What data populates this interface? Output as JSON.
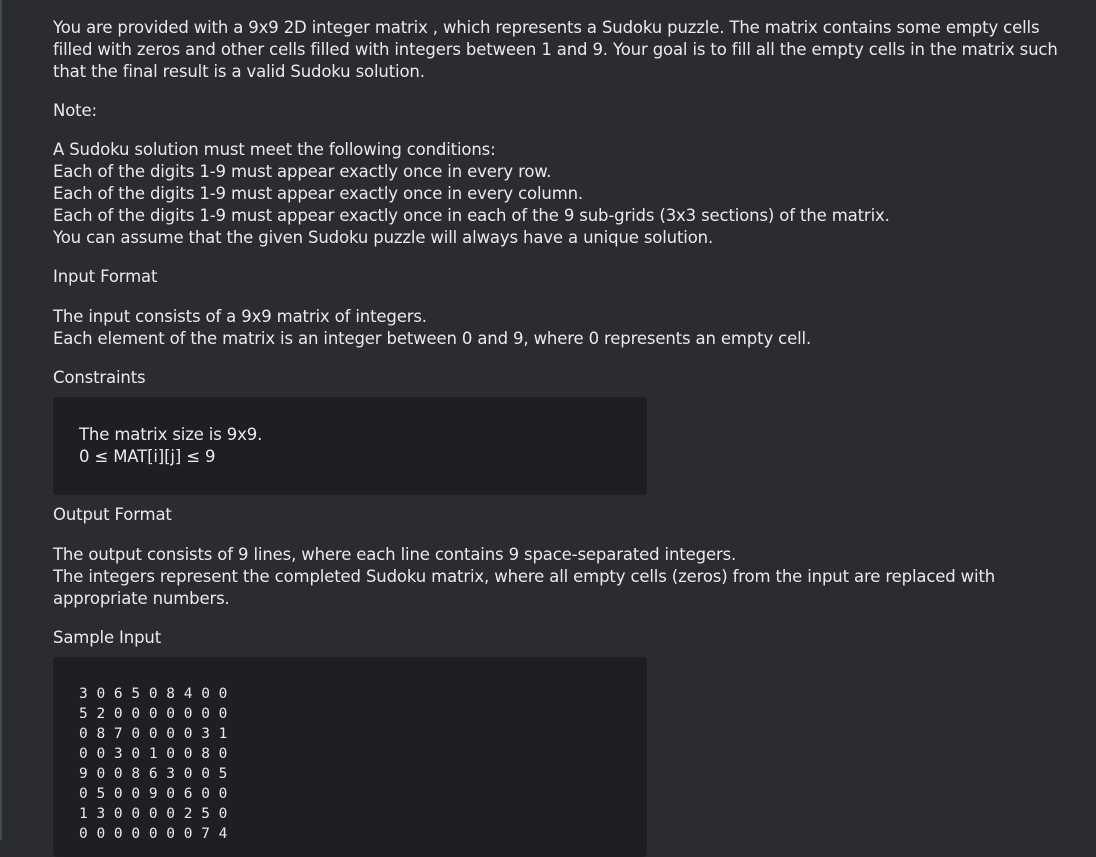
{
  "intro": {
    "lines": [
      "You are provided with a 9x9 2D integer matrix , which represents a Sudoku puzzle. The matrix contains some empty cells",
      "filled with zeros and other cells filled with integers between 1 and 9. Your goal is to fill all the empty cells in the matrix such",
      "that the final result is a valid Sudoku solution."
    ]
  },
  "note": {
    "heading": "Note:",
    "lines": [
      "A Sudoku solution must meet the following conditions:",
      "Each of the digits 1-9 must appear exactly once in every row.",
      "Each of the digits 1-9 must appear exactly once in every column.",
      "Each of the digits 1-9 must appear exactly once in each of the 9 sub-grids (3x3 sections) of the matrix.",
      "You can assume that the given Sudoku puzzle will always have a unique solution."
    ]
  },
  "input_format": {
    "heading": "Input Format",
    "lines": [
      "The input consists of a 9x9 matrix of integers.",
      "Each element of the matrix is an integer between 0 and 9, where 0 represents an empty cell."
    ]
  },
  "constraints": {
    "heading": "Constraints",
    "lines": [
      "The matrix size is 9x9.",
      "0 ≤ MAT[i][j] ≤ 9"
    ]
  },
  "output_format": {
    "heading": "Output Format",
    "lines": [
      "The output consists of 9 lines, where each line contains 9 space-separated integers.",
      "The integers represent the completed Sudoku matrix, where all empty cells (zeros) from the input are replaced with",
      "appropriate numbers."
    ]
  },
  "sample_input": {
    "heading": "Sample Input",
    "lines": [
      "3 0 6 5 0 8 4 0 0",
      "5 2 0 0 0 0 0 0 0",
      "0 8 7 0 0 0 0 3 1",
      "0 0 3 0 1 0 0 8 0",
      "9 0 0 8 6 3 0 0 5",
      "0 5 0 0 9 0 6 0 0",
      "1 3 0 0 0 0 2 5 0",
      "0 0 0 0 0 0 0 7 4"
    ]
  },
  "colors": {
    "page_background": "#2a2c2f",
    "code_block_background": "#1d1f22",
    "text": "#e9eaec"
  }
}
